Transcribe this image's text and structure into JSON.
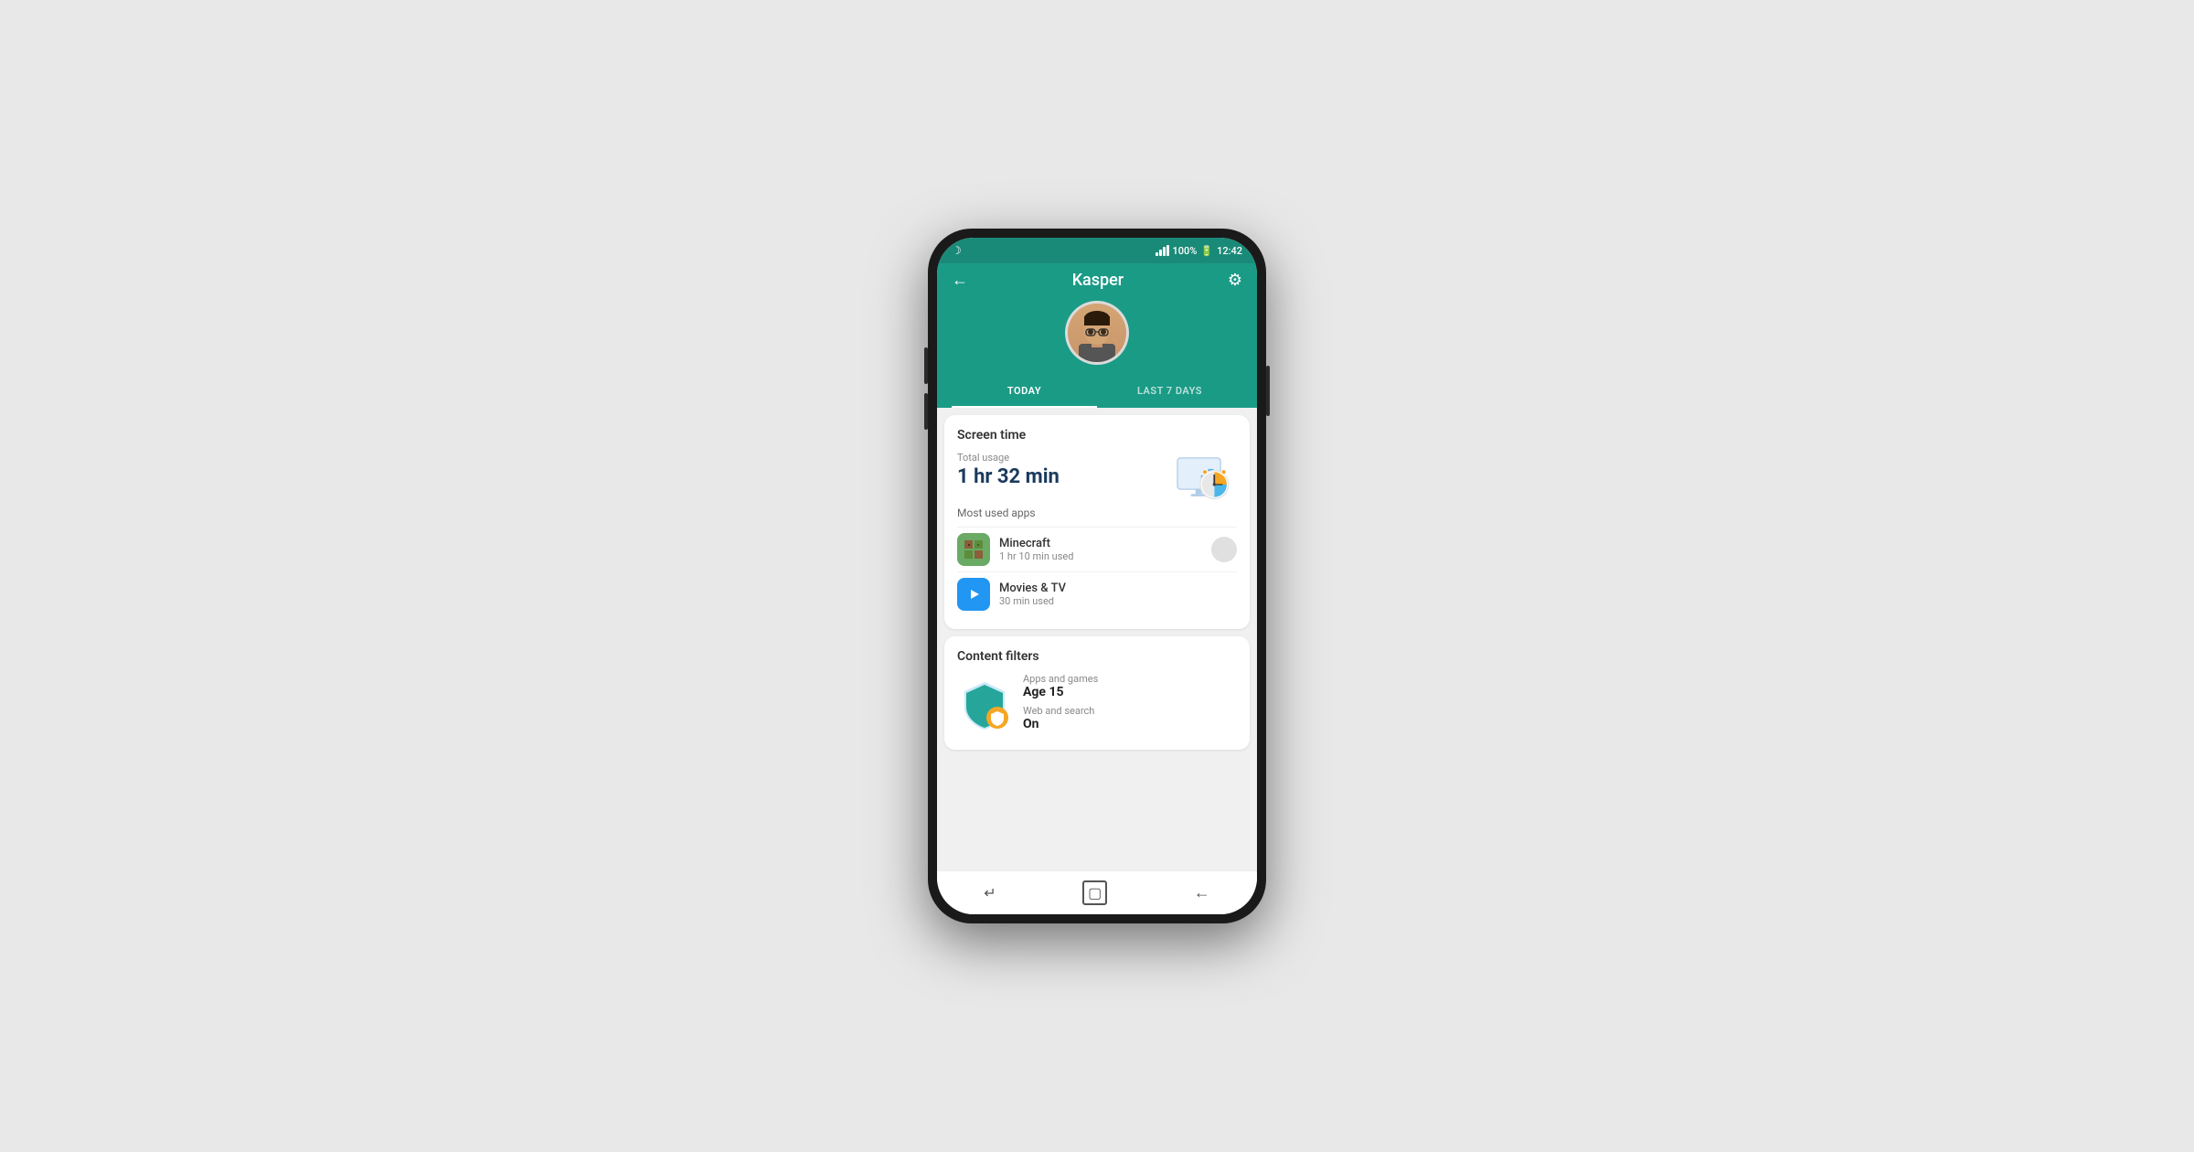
{
  "status_bar": {
    "time": "12:42",
    "battery": "100%",
    "moon_icon": "☽"
  },
  "header": {
    "title": "Kasper",
    "back_label": "←",
    "settings_label": "⚙"
  },
  "tabs": [
    {
      "id": "today",
      "label": "TODAY",
      "active": true
    },
    {
      "id": "last7",
      "label": "LAST 7 DAYS",
      "active": false
    }
  ],
  "screen_time": {
    "section_title": "Screen time",
    "usage_label": "Total usage",
    "usage_value": "1 hr 32 min",
    "most_used_label": "Most used apps",
    "apps": [
      {
        "name": "Minecraft",
        "time_used": "1 hr 10 min used",
        "icon_type": "minecraft"
      },
      {
        "name": "Movies & TV",
        "time_used": "30 min used",
        "icon_type": "movies"
      }
    ]
  },
  "content_filters": {
    "section_title": "Content filters",
    "apps_games_label": "Apps and games",
    "apps_games_value": "Age 15",
    "web_search_label": "Web and search",
    "web_search_value": "On"
  },
  "nav_bar": {
    "back_icon": "↵",
    "recents_icon": "▢",
    "home_back_icon": "←"
  }
}
